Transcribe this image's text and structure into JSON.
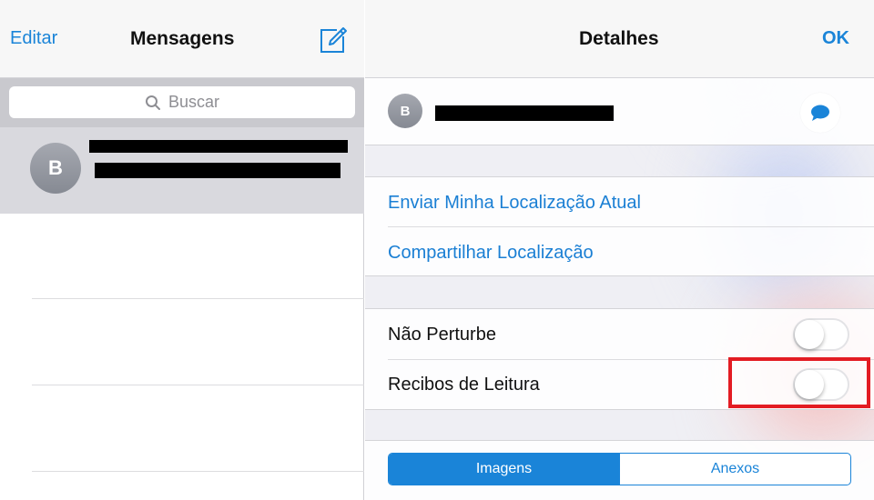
{
  "messages_panel": {
    "edit_label": "Editar",
    "title": "Mensagens",
    "compose_icon": "compose-icon",
    "search": {
      "placeholder": "Buscar",
      "icon": "search-icon"
    },
    "conversation": {
      "avatar_initial": "B"
    }
  },
  "details_panel": {
    "title": "Detalhes",
    "ok_label": "OK",
    "contact": {
      "avatar_initial": "B",
      "message_icon": "speech-bubble-icon"
    },
    "location": {
      "send_current": "Enviar Minha Localização Atual",
      "share": "Compartilhar Localização"
    },
    "settings": {
      "do_not_disturb": {
        "label": "Não Perturbe",
        "on": false
      },
      "read_receipts": {
        "label": "Recibos de Leitura",
        "on": false
      }
    },
    "segments": {
      "images": "Imagens",
      "attachments": "Anexos",
      "selected": "Imagens"
    }
  },
  "colors": {
    "accent": "#1a84d8",
    "highlight_box": "#e31c23",
    "selected_row": "#d9d9de",
    "grouped_background": "#efeff4"
  }
}
